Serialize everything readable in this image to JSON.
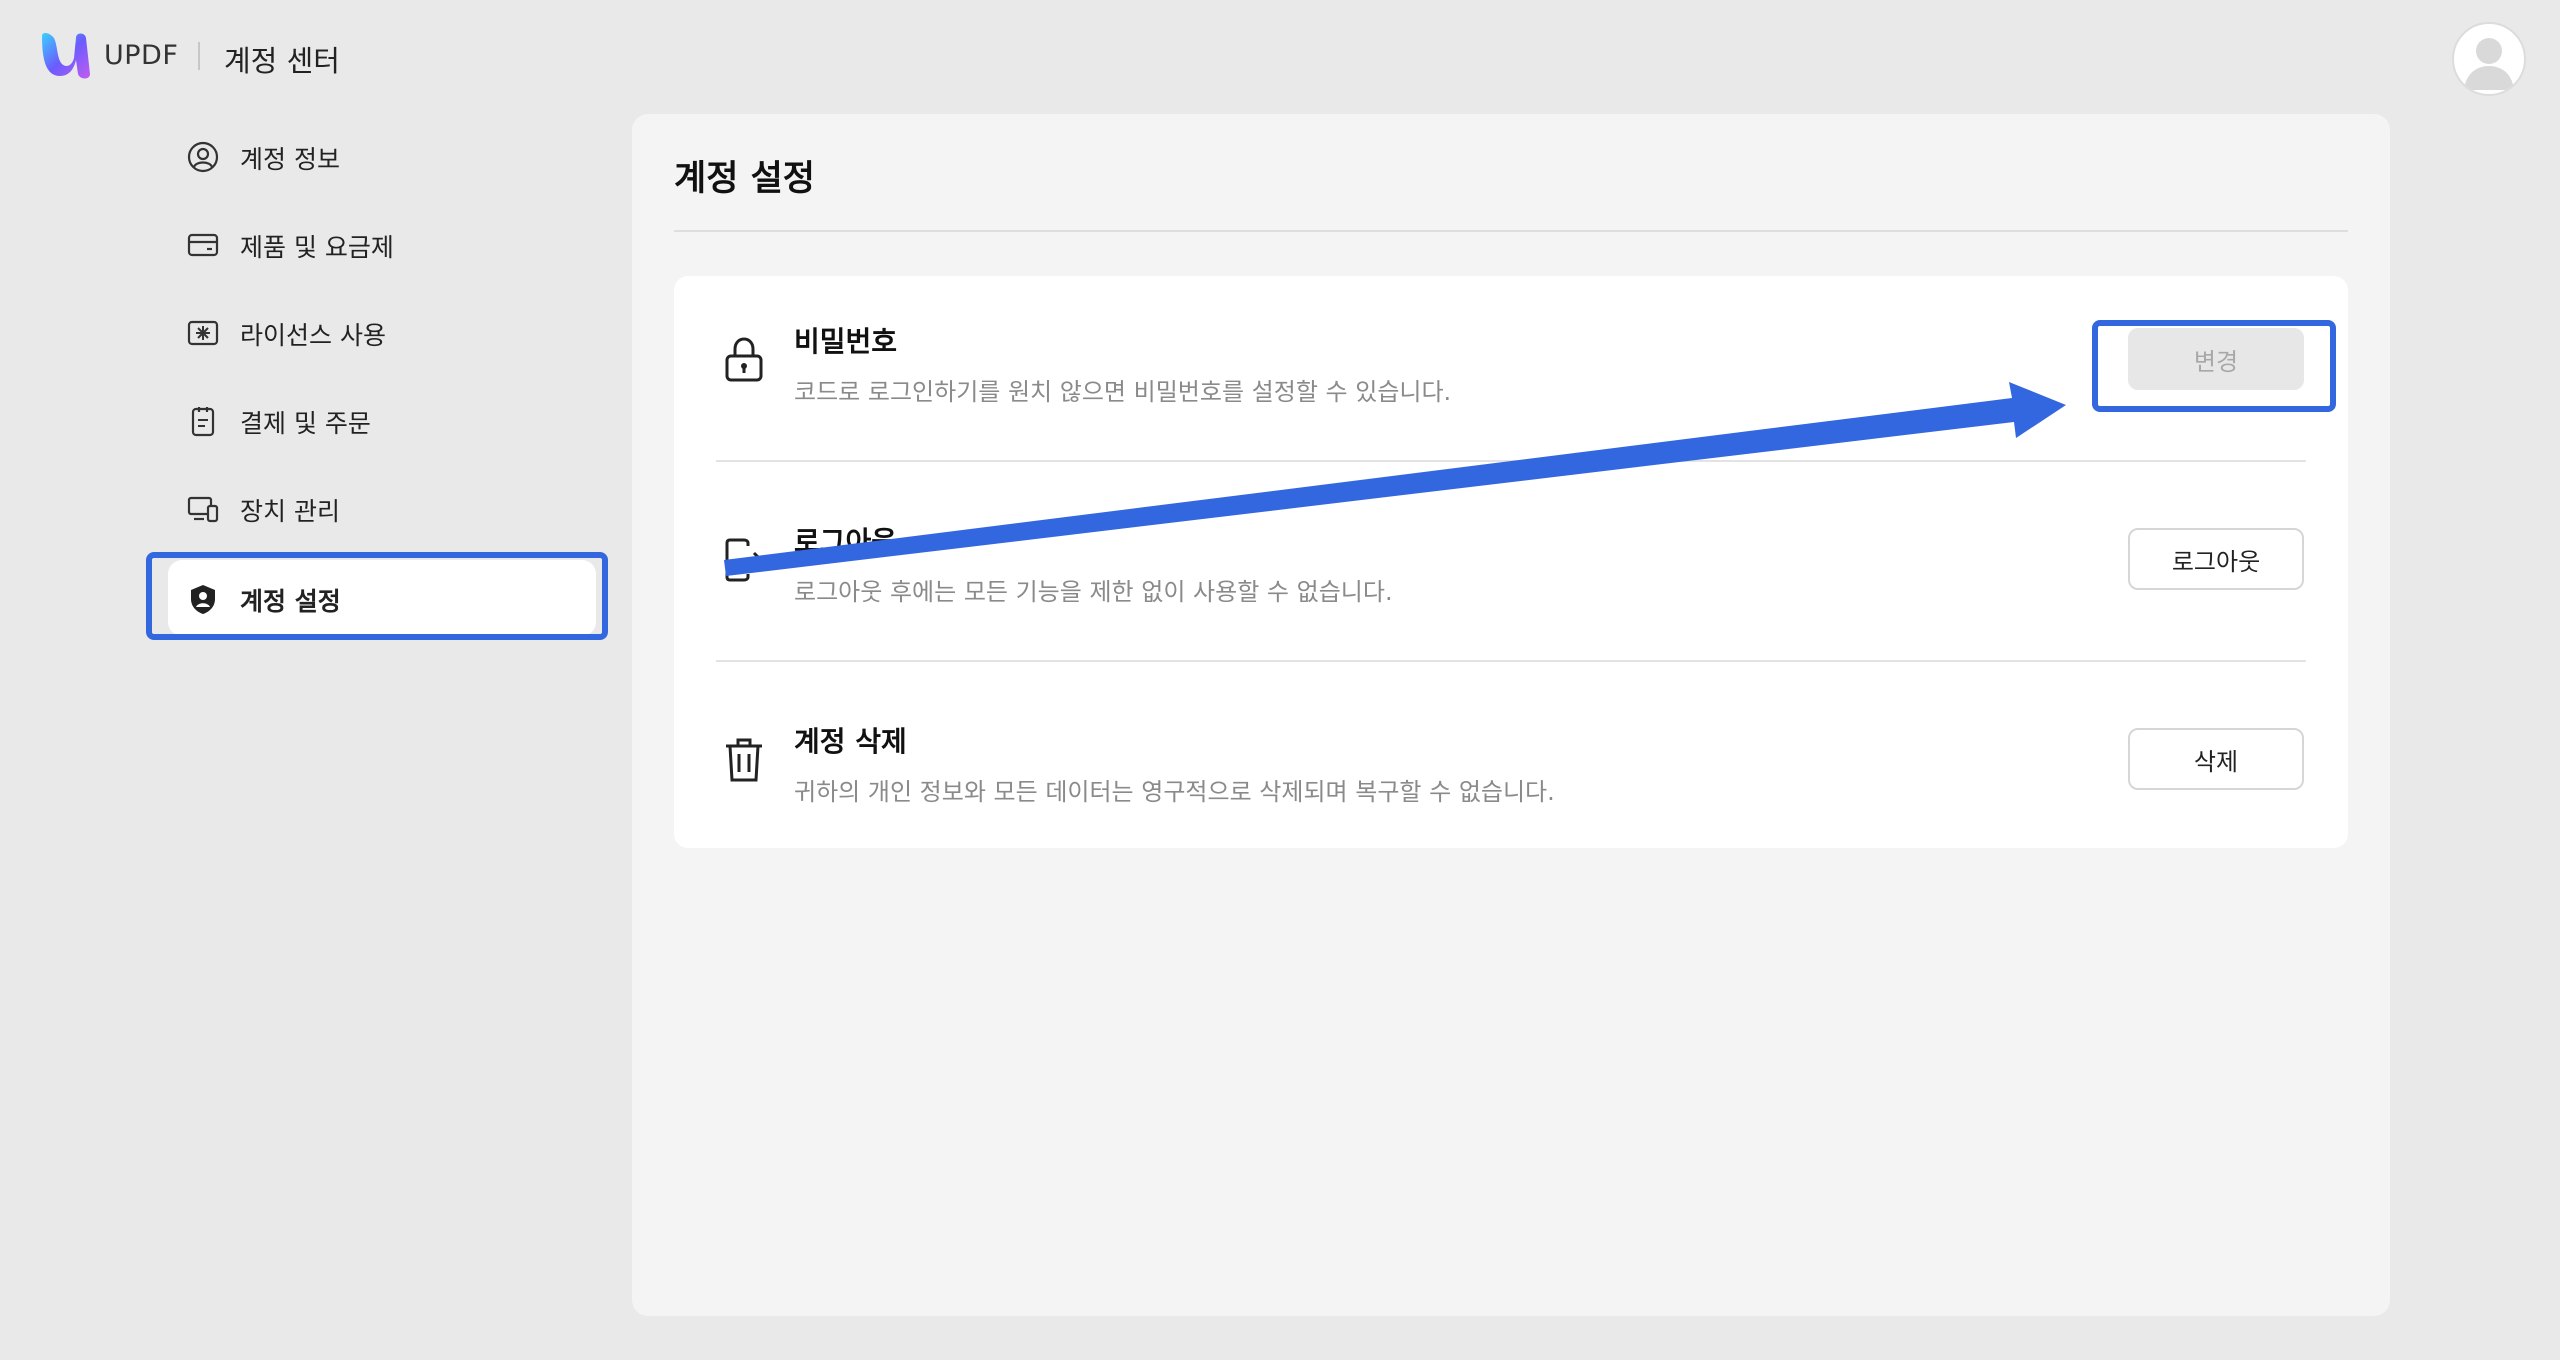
{
  "header": {
    "brand": "UPDF",
    "subtitle": "계정 센터",
    "logo_icon": "updf-logo-icon",
    "avatar_icon": "user-avatar-icon"
  },
  "sidebar": {
    "items": [
      {
        "label": "계정 정보",
        "icon": "user-circle-icon"
      },
      {
        "label": "제품 및 요금제",
        "icon": "card-icon"
      },
      {
        "label": "라이선스 사용",
        "icon": "license-icon"
      },
      {
        "label": "결제 및 주문",
        "icon": "clipboard-icon"
      },
      {
        "label": "장치 관리",
        "icon": "devices-icon"
      },
      {
        "label": "계정 설정",
        "icon": "shield-user-icon",
        "active": true
      }
    ]
  },
  "main": {
    "title": "계정 설정",
    "rows": [
      {
        "title": "비밀번호",
        "description": "코드로 로그인하기를 원치 않으면 비밀번호를 설정할 수 있습니다.",
        "button": "변경",
        "icon": "lock-icon",
        "button_disabled": true
      },
      {
        "title": "로그아웃",
        "description": "로그아웃 후에는 모든 기능을 제한 없이 사용할 수 없습니다.",
        "button": "로그아웃",
        "icon": "logout-icon"
      },
      {
        "title": "계정 삭제",
        "description": "귀하의 개인 정보와 모든 데이터는 영구적으로 삭제되며 복구할 수 없습니다.",
        "button": "삭제",
        "icon": "trash-icon"
      }
    ]
  },
  "colors": {
    "page_bg": "#e9e9e9",
    "panel_bg": "#f4f4f4",
    "annotation_blue": "#3367e0",
    "muted_text": "#8a8a8a"
  }
}
